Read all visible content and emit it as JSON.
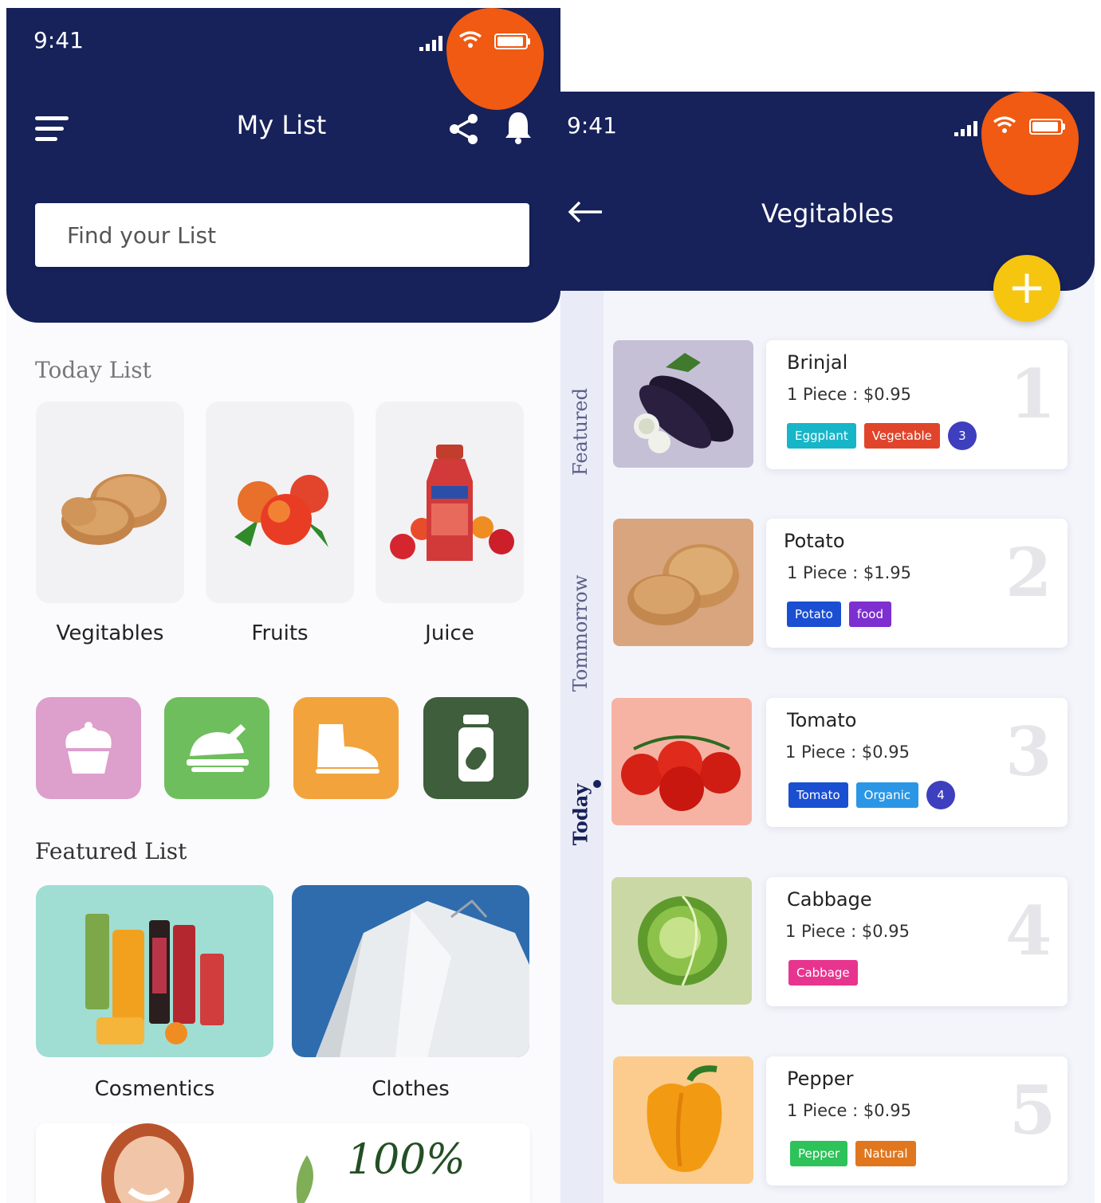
{
  "left": {
    "status": {
      "time": "9:41"
    },
    "header": {
      "title": "My List",
      "search_placeholder": "Find your List"
    },
    "today": {
      "title": "Today List",
      "cards": [
        {
          "label": "Vegitables",
          "icon": "potato-image"
        },
        {
          "label": "Fruits",
          "icon": "peach-image"
        },
        {
          "label": "Juice",
          "icon": "juice-bottle-image"
        }
      ]
    },
    "categories": [
      {
        "icon": "cupcake-icon",
        "color": "#dd9fcc"
      },
      {
        "icon": "roast-chicken-icon",
        "color": "#6fbe5e"
      },
      {
        "icon": "boot-icon",
        "color": "#f3a33b"
      },
      {
        "icon": "medicine-bottle-icon",
        "color": "#3f5e3c"
      }
    ],
    "featured": {
      "title": "Featured List",
      "cards": [
        {
          "label": "Cosmentics",
          "color": "#a0ded3"
        },
        {
          "label": "Clothes",
          "color": "#2f6cad"
        }
      ],
      "banner_text": "100%"
    }
  },
  "right": {
    "status": {
      "time": "9:41"
    },
    "header": {
      "title": "Vegitables",
      "add_label": "+"
    },
    "tabs": [
      "Featured",
      "Tommorrow",
      "Today"
    ],
    "items": [
      {
        "name": "Brinjal",
        "price": "1 Piece : $0.95",
        "rank": "1",
        "bg": "#c6c0d6",
        "tags": [
          {
            "text": "Eggplant",
            "color": "#17b5c8"
          },
          {
            "text": "Vegetable",
            "color": "#e0452c"
          }
        ],
        "count": "3"
      },
      {
        "name": "Potato",
        "price": "1 Piece : $1.95",
        "rank": "2",
        "bg": "#d9a57f",
        "tags": [
          {
            "text": "Potato",
            "color": "#1b4fd2"
          },
          {
            "text": "food",
            "color": "#7d2fd0"
          }
        ],
        "count": ""
      },
      {
        "name": "Tomato",
        "price": "1 Piece : $0.95",
        "rank": "3",
        "bg": "#f6b3a3",
        "tags": [
          {
            "text": "Tomato",
            "color": "#1b4fd2"
          },
          {
            "text": "Organic",
            "color": "#2b96e5"
          }
        ],
        "count": "4"
      },
      {
        "name": "Cabbage",
        "price": "1 Piece : $0.95",
        "rank": "4",
        "bg": "#cad8a6",
        "tags": [
          {
            "text": "Cabbage",
            "color": "#e7358f"
          }
        ],
        "count": ""
      },
      {
        "name": "Pepper",
        "price": "1 Piece : $0.95",
        "rank": "5",
        "bg": "#fbcc8d",
        "tags": [
          {
            "text": "Pepper",
            "color": "#2ec25a"
          },
          {
            "text": "Natural",
            "color": "#e0771e"
          }
        ],
        "count": ""
      }
    ]
  },
  "colors": {
    "header": "#17215a",
    "accent_blob": "#f05a12",
    "fab": "#f6c510"
  }
}
